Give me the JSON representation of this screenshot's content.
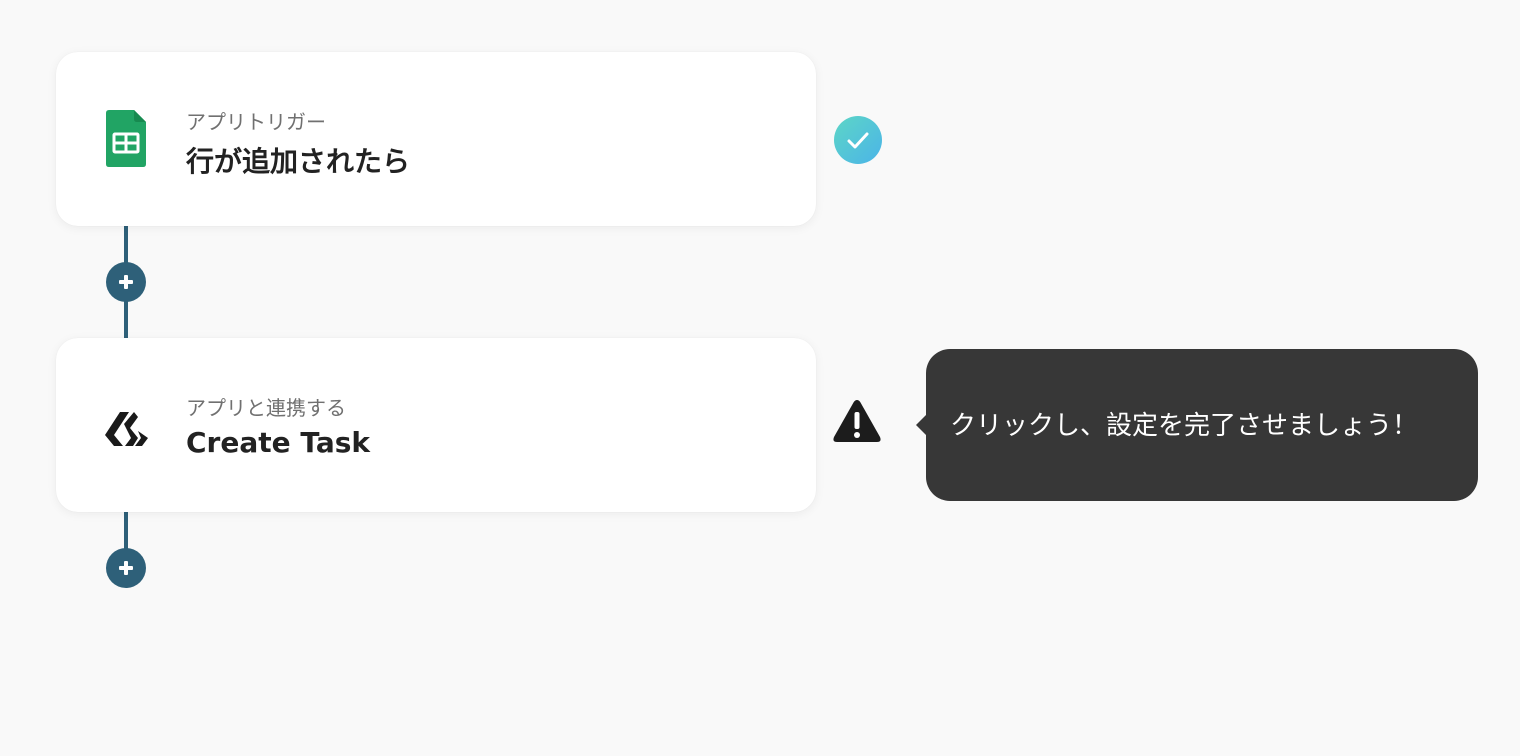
{
  "flow": {
    "steps": [
      {
        "subtitle": "アプリトリガー",
        "title": "行が追加されたら",
        "app_icon": "google-sheets-icon",
        "status": "complete"
      },
      {
        "subtitle": "アプリと連携する",
        "title": "Create Task",
        "app_icon": "task-app-logo-icon",
        "status": "incomplete"
      }
    ],
    "tooltip": {
      "text": "クリックし、設定を完了させましょう！"
    }
  },
  "colors": {
    "background": "#f9f9f9",
    "connector": "#2e6079",
    "check_gradient_start": "#5dd6c6",
    "check_gradient_end": "#4bb4e8",
    "tooltip_bg": "#373737",
    "sheets_green": "#21a464",
    "warning": "#1c1c1c"
  }
}
